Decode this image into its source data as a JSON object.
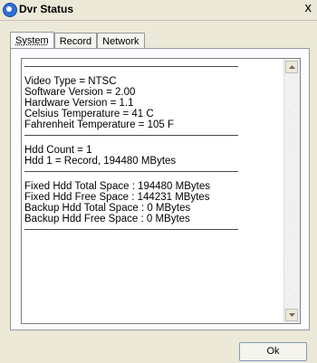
{
  "window": {
    "title": "Dvr Status",
    "close_glyph": "x"
  },
  "tabs": [
    {
      "label": "System",
      "active": true
    },
    {
      "label": "Record",
      "active": false
    },
    {
      "label": "Network",
      "active": false
    }
  ],
  "status": {
    "video_type": "Video Type = NTSC",
    "software_version": "Software Version = 2.00",
    "hardware_version": "Hardware Version = 1.1",
    "celsius_temp": "Celsius Temperature = 41 C",
    "fahrenheit_temp": "Fahrenheit Temperature = 105 F",
    "hdd_count": "Hdd Count = 1",
    "hdd_1": "Hdd 1 = Record, 194480 MBytes",
    "fixed_total": "Fixed Hdd Total Space : 194480 MBytes",
    "fixed_free": "Fixed Hdd Free Space : 144231 MBytes",
    "backup_total": "Backup Hdd Total Space : 0 MBytes",
    "backup_free": "Backup Hdd Free Space : 0 MBytes"
  },
  "buttons": {
    "ok": "Ok"
  },
  "icons": {
    "app": "dvr-app-icon",
    "close": "close-icon",
    "scroll_up": "arrow-up-icon",
    "scroll_down": "arrow-down-icon"
  }
}
